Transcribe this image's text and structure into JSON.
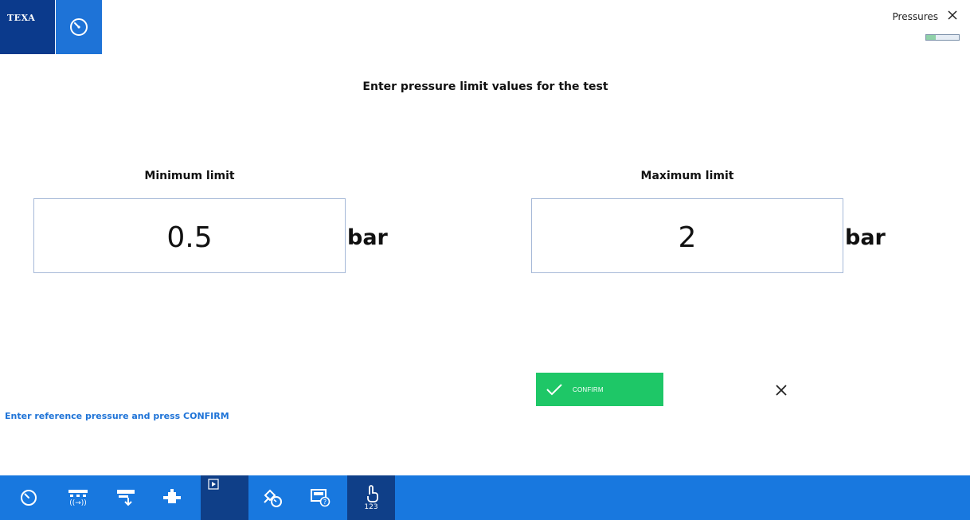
{
  "header": {
    "brand": "TEXA",
    "module_title": "Pressures",
    "progress_fraction": 0.3
  },
  "main": {
    "title": "Enter pressure  limit values for the test",
    "min": {
      "label": "Minimum limit",
      "value": "0.5",
      "unit": "bar"
    },
    "max": {
      "label": "Maximum limit",
      "value": "2",
      "unit": "bar"
    }
  },
  "actions": {
    "confirm_label": "CONFIRM"
  },
  "hint": "Enter reference pressure and press CONFIRM",
  "toolbar": {
    "items": [
      {
        "icon": "gauge-icon"
      },
      {
        "icon": "signal-exchange-icon",
        "sublabel": "((→))"
      },
      {
        "icon": "bypass-icon"
      },
      {
        "icon": "component-icon"
      },
      {
        "icon": "play-icon"
      },
      {
        "icon": "satellite-gauge-icon"
      },
      {
        "icon": "calculator-help-icon"
      },
      {
        "icon": "touch-keypad-icon",
        "sublabel": "123"
      }
    ]
  },
  "colors": {
    "brand_dark": "#0b3a8c",
    "brand_blue": "#1e73d7",
    "toolbar_blue": "#1878df",
    "confirm_green": "#1ec767"
  }
}
